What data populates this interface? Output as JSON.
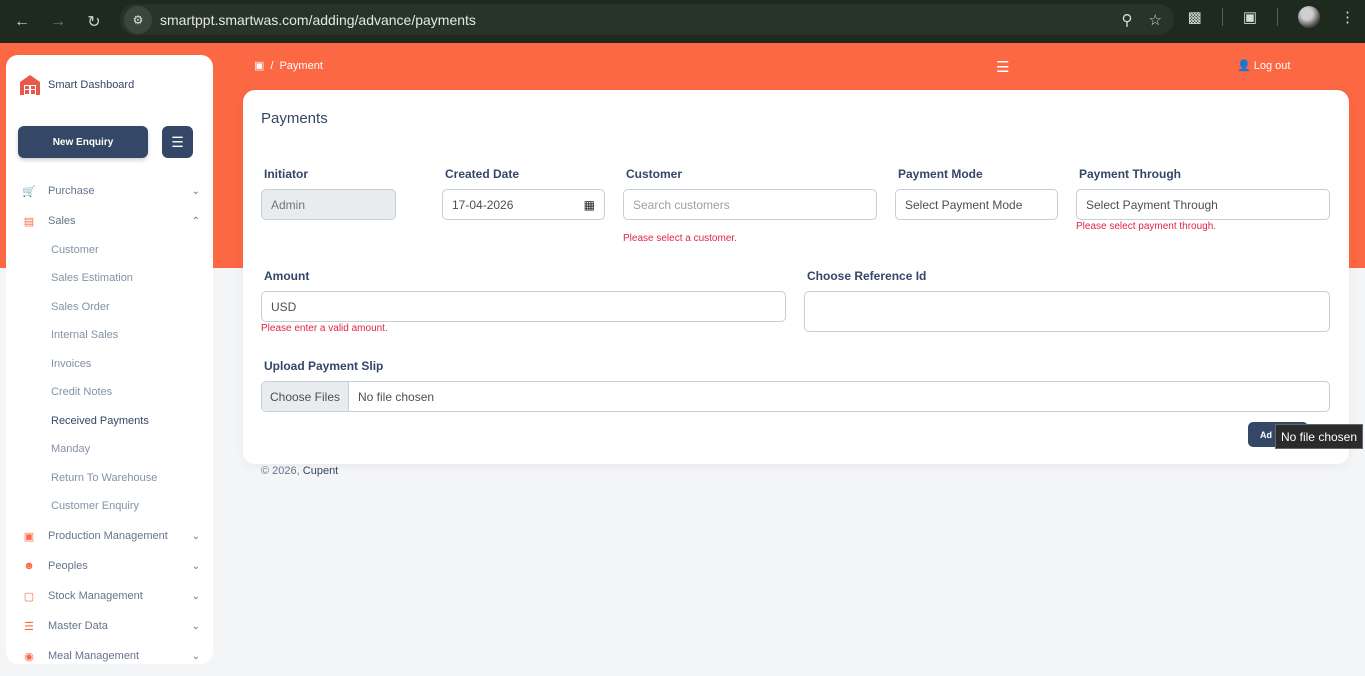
{
  "browser": {
    "url": "smartppt.smartwas.com/adding/advance/payments"
  },
  "sidebar": {
    "brand": "Smart Dashboard",
    "new_enquiry": "New Enquiry",
    "items": [
      {
        "label": "Purchase",
        "icon": "cart-icon"
      },
      {
        "label": "Sales",
        "icon": "receipt-icon"
      },
      {
        "label": "Production Management",
        "icon": "factory-icon"
      },
      {
        "label": "Peoples",
        "icon": "people-icon"
      },
      {
        "label": "Stock Management",
        "icon": "box-icon"
      },
      {
        "label": "Master Data",
        "icon": "database-icon"
      },
      {
        "label": "Meal Management",
        "icon": "meal-icon"
      }
    ],
    "sales_sub": [
      "Customer",
      "Sales Estimation",
      "Sales Order",
      "Internal Sales",
      "Invoices",
      "Credit Notes",
      "Received Payments",
      "Manday",
      "Return To Warehouse",
      "Customer Enquiry"
    ]
  },
  "header": {
    "breadcrumb_sep": "/",
    "breadcrumb_page": "Payment",
    "logout": "Log out"
  },
  "form": {
    "title": "Payments",
    "initiator_label": "Initiator",
    "initiator_value": "Admin",
    "created_date_label": "Created Date",
    "created_date_value": "17-04-2026",
    "customer_label": "Customer",
    "customer_placeholder": "Search customers",
    "customer_error": "Please select a customer.",
    "payment_mode_label": "Payment Mode",
    "payment_mode_value": "Select Payment Mode",
    "payment_through_label": "Payment Through",
    "payment_through_value": "Select Payment Through",
    "payment_through_error": "Please select payment through.",
    "amount_label": "Amount",
    "amount_value": "USD",
    "amount_error": "Please enter a valid amount.",
    "reference_label": "Choose Reference Id",
    "upload_label": "Upload Payment Slip",
    "choose_files": "Choose Files",
    "no_file": "No file chosen",
    "add_button": "Ad",
    "tooltip": "No file chosen"
  },
  "footer": {
    "copyright": "© 2026,",
    "company": "Cupent"
  }
}
